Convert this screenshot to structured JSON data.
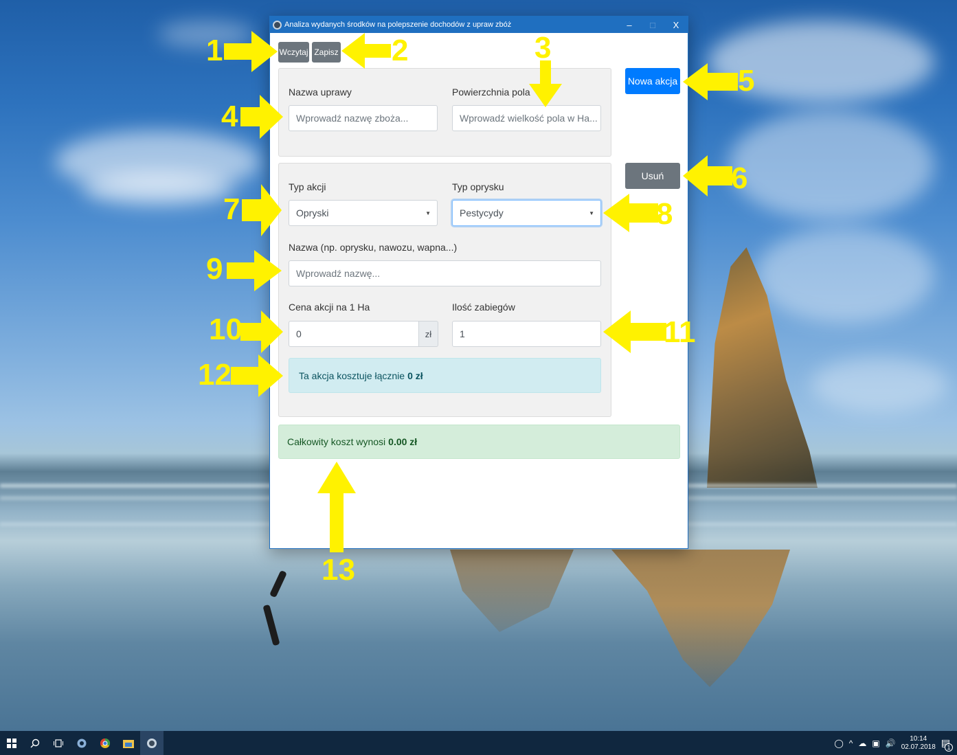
{
  "window": {
    "title": "Analiza wydanych środków na polepszenie dochodów z upraw zbóż",
    "minimize": "–",
    "maximize": "□",
    "close": "X"
  },
  "toolbar": {
    "load_label": "Wczytaj",
    "save_label": "Zapisz"
  },
  "crop_panel": {
    "crop_name_label": "Nazwa uprawy",
    "crop_name_placeholder": "Wprowadź nazwę zboża...",
    "field_area_label": "Powierzchnia pola",
    "field_area_placeholder": "Wprowadź wielkość pola w Ha..."
  },
  "side_buttons": {
    "new_action": "Nowa akcja",
    "delete": "Usuń"
  },
  "action_panel": {
    "action_type_label": "Typ akcji",
    "action_type_value": "Opryski",
    "spray_type_label": "Typ oprysku",
    "spray_type_value": "Pestycydy",
    "name_label": "Nazwa (np. oprysku, nawozu, wapna...)",
    "name_placeholder": "Wprowadź nazwę...",
    "price_label": "Cena akcji na 1 Ha",
    "price_value": "0",
    "currency": "zł",
    "count_label": "Ilość zabiegów",
    "count_value": "1",
    "action_cost_text": "Ta akcja kosztuje łącznie",
    "action_cost_value": "0 zł"
  },
  "total": {
    "text": "Całkowity koszt wynosi",
    "value": "0.00 zł"
  },
  "annotations": {
    "n1": "1",
    "n2": "2",
    "n3": "3",
    "n4": "4",
    "n5": "5",
    "n6": "6",
    "n7": "7",
    "n8": "8",
    "n9": "9",
    "n10": "10",
    "n11": "11",
    "n12": "12",
    "n13": "13"
  },
  "taskbar": {
    "time": "10:14",
    "date": "02.07.2018",
    "notification_count": "1"
  },
  "colors": {
    "annotation": "#fff200",
    "primary": "#007bff",
    "secondary": "#6c757d"
  }
}
